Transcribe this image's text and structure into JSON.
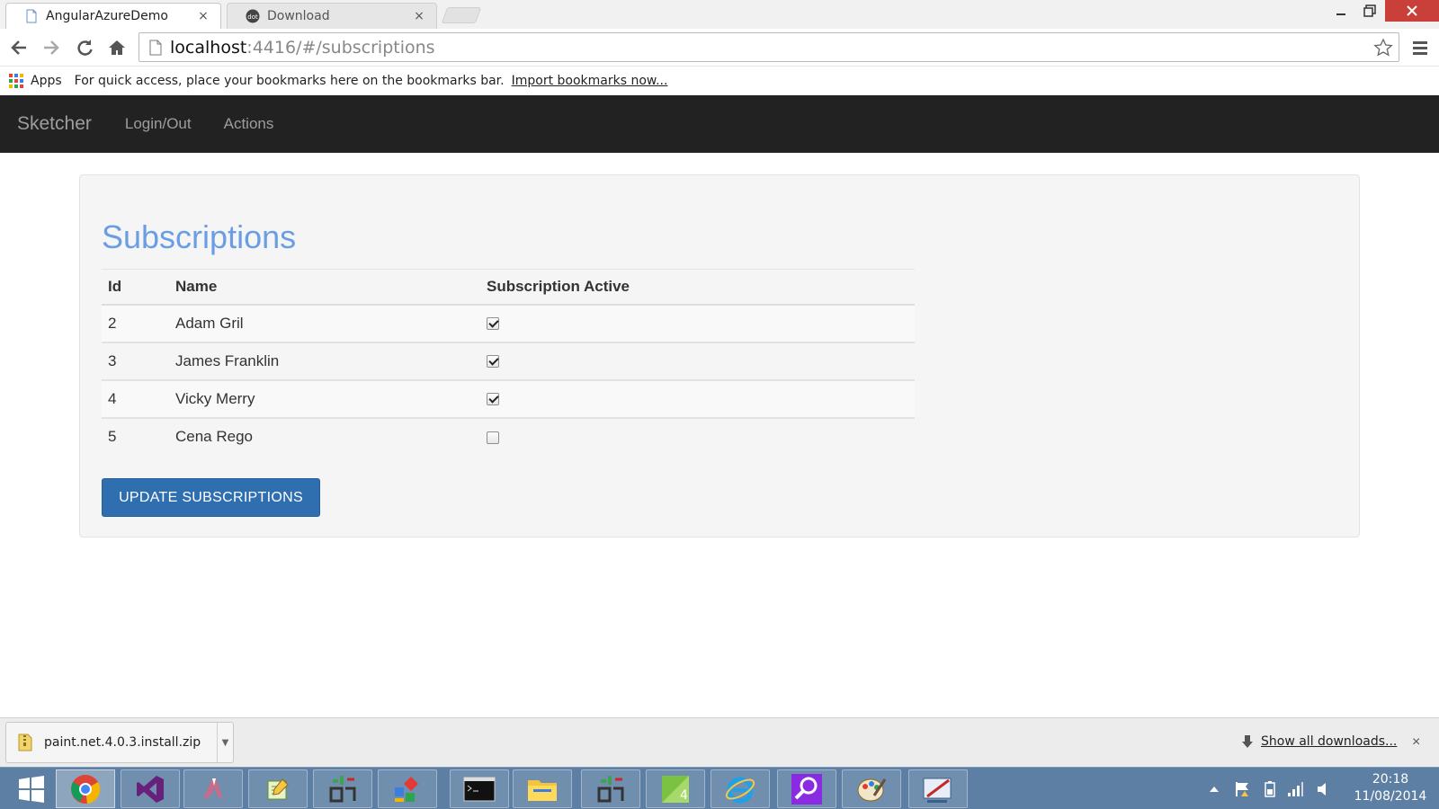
{
  "browser": {
    "tabs": [
      {
        "title": "AngularAzureDemo",
        "active": true,
        "close": "×"
      },
      {
        "title": "Download",
        "active": false,
        "close": "×"
      }
    ],
    "address": {
      "host": "localhost",
      "rest": ":4416/#/subscriptions"
    },
    "bookmarks": {
      "apps_label": "Apps",
      "hint": "For quick access, place your bookmarks here on the bookmarks bar.",
      "import_link": "Import bookmarks now..."
    },
    "icons": [
      "back-icon",
      "forward-icon",
      "reload-icon",
      "home-icon",
      "page-icon",
      "star-icon",
      "menu-icon"
    ]
  },
  "app": {
    "brand": "Sketcher",
    "nav": [
      {
        "label": "Login/Out"
      },
      {
        "label": "Actions"
      }
    ],
    "page_title": "Subscriptions",
    "table": {
      "headers": {
        "id": "Id",
        "name": "Name",
        "active": "Subscription Active"
      },
      "rows": [
        {
          "id": "2",
          "name": "Adam Gril",
          "active": true
        },
        {
          "id": "3",
          "name": "James Franklin",
          "active": true
        },
        {
          "id": "4",
          "name": "Vicky Merry",
          "active": true
        },
        {
          "id": "5",
          "name": "Cena Rego",
          "active": false
        }
      ]
    },
    "update_button": "UPDATE SUBSCRIPTIONS",
    "colors": {
      "heading": "#6a9ee4",
      "button": "#2f6fb0",
      "navbar": "#222222"
    }
  },
  "downloads": {
    "file": "paint.net.4.0.3.install.zip",
    "show_all": "Show all downloads...",
    "close": "×"
  },
  "taskbar": {
    "apps": [
      "start-icon",
      "chrome-icon",
      "visual-studio-icon",
      "app-icon",
      "notepad-icon",
      "tool-icon",
      "office-icon",
      "terminal-icon",
      "file-explorer-icon",
      "tool2-icon",
      "app4-icon",
      "internet-explorer-icon",
      "search-tool-icon",
      "paint-icon",
      "snipping-tool-icon"
    ],
    "time": "20:18",
    "date": "11/08/2014"
  }
}
